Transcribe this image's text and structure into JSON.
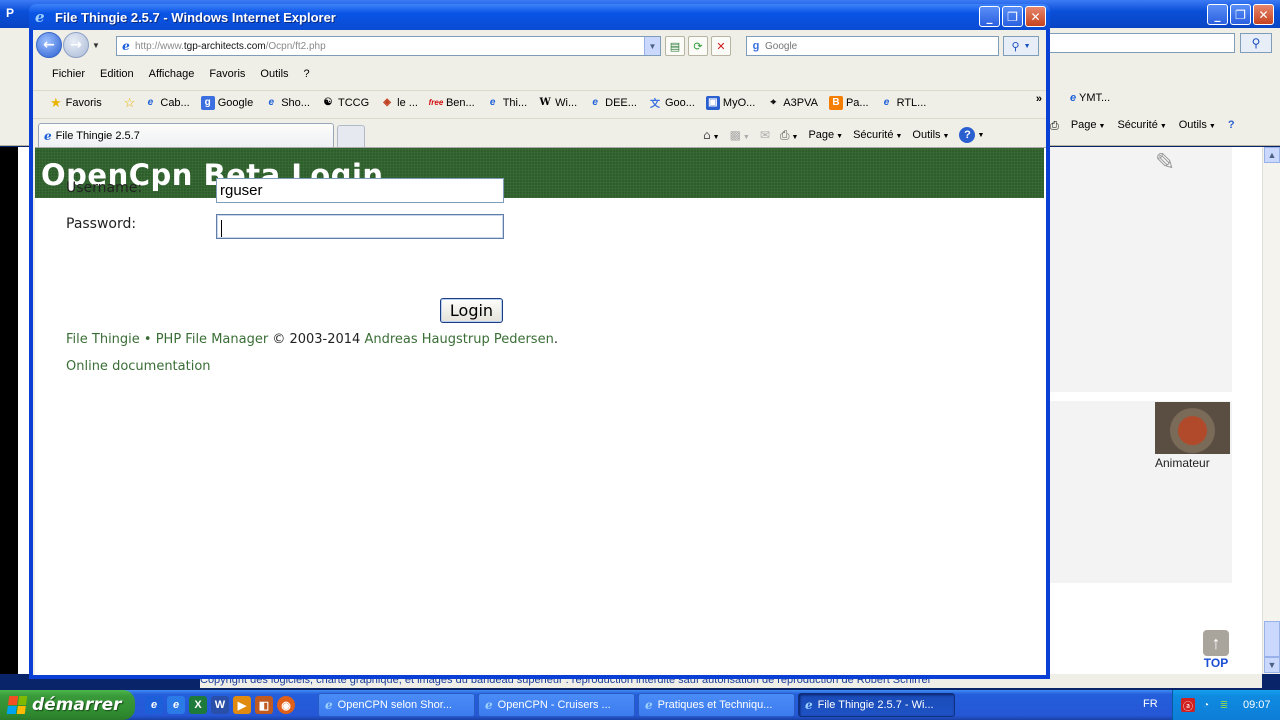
{
  "background_window": {
    "title": "P",
    "links_text": "YMT...",
    "cmd": {
      "page": "Page",
      "security": "Sécurité",
      "tools": "Outils"
    },
    "animateur": "Animateur",
    "top_label": "TOP",
    "copyright": "Copyright des logiciels, charte graphique, et images du bandeau supérieur : reproduction interdite sauf autorisation de reproduction de Robert Schirrer"
  },
  "window": {
    "title": "File Thingie 2.5.7 - Windows Internet Explorer",
    "address_prefix": "http://www.",
    "address_domain": "tgp-architects.com",
    "address_path": "/Ocpn/ft2.php",
    "search_placeholder": "Google"
  },
  "menu": [
    "Fichier",
    "Edition",
    "Affichage",
    "Favoris",
    "Outils",
    "?"
  ],
  "favorites": {
    "label": "Favoris",
    "items": [
      {
        "label": "Cab...",
        "icon": "ie-icon"
      },
      {
        "label": "Google",
        "icon": "google-icon"
      },
      {
        "label": "Sho...",
        "icon": "ie-icon"
      },
      {
        "label": "TCCG",
        "icon": "tccg-icon"
      },
      {
        "label": "le ...",
        "icon": "cube-icon"
      },
      {
        "label": "Ben...",
        "icon": "free-icon"
      },
      {
        "label": "Thi...",
        "icon": "ie-icon"
      },
      {
        "label": "Wi...",
        "icon": "wikipedia-icon"
      },
      {
        "label": "DEE...",
        "icon": "ie-icon"
      },
      {
        "label": "Goo...",
        "icon": "translate-icon"
      },
      {
        "label": "MyO...",
        "icon": "myo-icon"
      },
      {
        "label": "A3PVA",
        "icon": "a3pva-icon"
      },
      {
        "label": "Pa...",
        "icon": "blogger-icon"
      },
      {
        "label": "RTL...",
        "icon": "ie-icon"
      }
    ]
  },
  "tab": {
    "label": "File Thingie 2.5.7"
  },
  "commandbar": {
    "page": "Page",
    "security": "Sécurité",
    "tools": "Outils"
  },
  "page": {
    "heading": "OpenCpn Beta Login",
    "username_label": "Username:",
    "username_value": "rguser",
    "password_label": "Password:",
    "password_value": "",
    "login_button": "Login",
    "footer": {
      "app_link": "File Thingie",
      "sep": " • ",
      "manager_link": "PHP File Manager",
      "copy": " © 2003-2014 ",
      "author_link": "Andreas Haugstrup Pedersen",
      "end": "."
    },
    "docs_link": "Online documentation"
  },
  "taskbar": {
    "start": "démarrer",
    "tasks": [
      {
        "label": "OpenCPN selon Shor..."
      },
      {
        "label": "OpenCPN - Cruisers ..."
      },
      {
        "label": "Pratiques et Techniqu..."
      },
      {
        "label": "File Thingie 2.5.7 - Wi..."
      }
    ],
    "lang": "FR",
    "clock": "09:07"
  }
}
